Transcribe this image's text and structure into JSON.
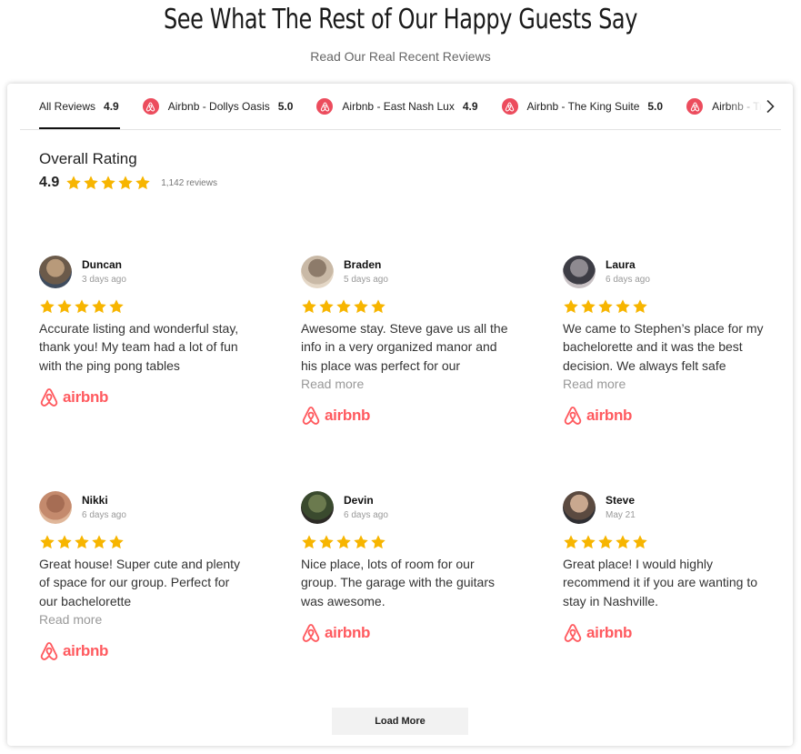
{
  "header": {
    "title": "See What The Rest of Our Happy Guests Say",
    "subtitle": "Read Our Real Recent Reviews"
  },
  "tabs": [
    {
      "label": "All Reviews",
      "rating": "4.9",
      "logo": null,
      "active": true
    },
    {
      "label": "Airbnb - Dollys Oasis",
      "rating": "5.0",
      "logo": "airbnb-icon",
      "active": false
    },
    {
      "label": "Airbnb - East Nash Lux",
      "rating": "4.9",
      "logo": "airbnb-icon",
      "active": false
    },
    {
      "label": "Airbnb - The King Suite",
      "rating": "5.0",
      "logo": "airbnb-icon",
      "active": false
    },
    {
      "label": "Airbnb - Tr",
      "rating": "",
      "logo": "airbnb-icon",
      "active": false
    }
  ],
  "overall": {
    "title": "Overall Rating",
    "score": "4.9",
    "stars": 5,
    "count_text": "1,142  reviews"
  },
  "reviews": [
    {
      "name": "Duncan",
      "date": "3 days ago",
      "stars": 5,
      "text": "Accurate listing and wonderful stay, thank you! My team had a lot of fun with the ping pong tables",
      "read_more": "",
      "brand": "airbnb"
    },
    {
      "name": "Braden",
      "date": "5 days ago",
      "stars": 5,
      "text": "Awesome stay. Steve gave us all the info in a very organized manor and his place was perfect for our",
      "read_more": "Read more",
      "brand": "airbnb"
    },
    {
      "name": "Laura",
      "date": "6 days ago",
      "stars": 5,
      "text": "We came to Stephen’s place for my bachelorette and it was the best decision. We always felt safe",
      "read_more": "Read more",
      "brand": "airbnb"
    },
    {
      "name": "Nikki",
      "date": "6 days ago",
      "stars": 5,
      "text": "Great house! Super cute and plenty of space for our group. Perfect for our bachelorette",
      "read_more": "Read more",
      "brand": "airbnb"
    },
    {
      "name": "Devin",
      "date": "6 days ago",
      "stars": 5,
      "text": "Nice place, lots of room for our group. The garage with the guitars was awesome.",
      "read_more": "",
      "brand": "airbnb"
    },
    {
      "name": "Steve",
      "date": "May 21",
      "stars": 5,
      "text": "Great place! I would highly recommend it if you are wanting to stay in Nashville.",
      "read_more": "",
      "brand": "airbnb"
    }
  ],
  "load_more_label": "Load More",
  "colors": {
    "star": "#f7b500",
    "airbnb": "#ff5a5f",
    "tab_logo_bg": "#ec4c5d"
  }
}
